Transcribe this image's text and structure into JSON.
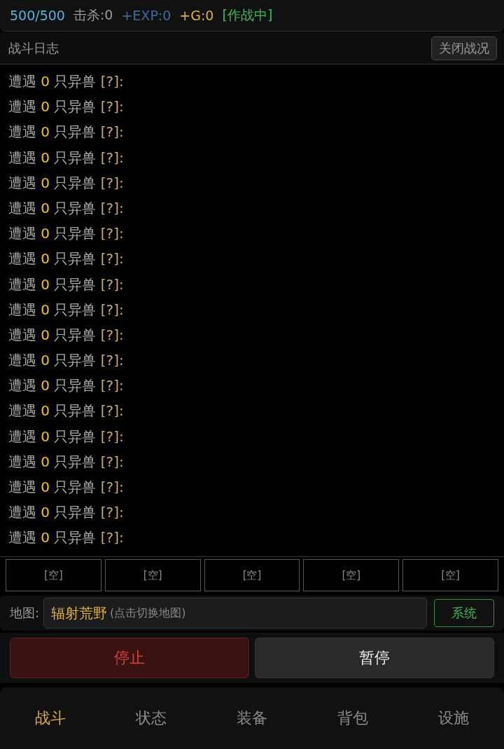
{
  "status_bar": {
    "hp": "500/500",
    "kills": "击杀:0",
    "exp": "+EXP:0",
    "gold": "+G:0",
    "state": "[作战中]"
  },
  "log_header": {
    "title": "战斗日志",
    "close_button": "关闭战况"
  },
  "log_entries": [
    {
      "verb": "遭遇",
      "count": "0",
      "noun": "只异兽",
      "tag": "[?]:"
    },
    {
      "verb": "遭遇",
      "count": "0",
      "noun": "只异兽",
      "tag": "[?]:"
    },
    {
      "verb": "遭遇",
      "count": "0",
      "noun": "只异兽",
      "tag": "[?]:"
    },
    {
      "verb": "遭遇",
      "count": "0",
      "noun": "只异兽",
      "tag": "[?]:"
    },
    {
      "verb": "遭遇",
      "count": "0",
      "noun": "只异兽",
      "tag": "[?]:"
    },
    {
      "verb": "遭遇",
      "count": "0",
      "noun": "只异兽",
      "tag": "[?]:"
    },
    {
      "verb": "遭遇",
      "count": "0",
      "noun": "只异兽",
      "tag": "[?]:"
    },
    {
      "verb": "遭遇",
      "count": "0",
      "noun": "只异兽",
      "tag": "[?]:"
    },
    {
      "verb": "遭遇",
      "count": "0",
      "noun": "只异兽",
      "tag": "[?]:"
    },
    {
      "verb": "遭遇",
      "count": "0",
      "noun": "只异兽",
      "tag": "[?]:"
    },
    {
      "verb": "遭遇",
      "count": "0",
      "noun": "只异兽",
      "tag": "[?]:"
    },
    {
      "verb": "遭遇",
      "count": "0",
      "noun": "只异兽",
      "tag": "[?]:"
    },
    {
      "verb": "遭遇",
      "count": "0",
      "noun": "只异兽",
      "tag": "[?]:"
    },
    {
      "verb": "遭遇",
      "count": "0",
      "noun": "只异兽",
      "tag": "[?]:"
    },
    {
      "verb": "遭遇",
      "count": "0",
      "noun": "只异兽",
      "tag": "[?]:"
    },
    {
      "verb": "遭遇",
      "count": "0",
      "noun": "只异兽",
      "tag": "[?]:"
    },
    {
      "verb": "遭遇",
      "count": "0",
      "noun": "只异兽",
      "tag": "[?]:"
    },
    {
      "verb": "遭遇",
      "count": "0",
      "noun": "只异兽",
      "tag": "[?]:"
    },
    {
      "verb": "遭遇",
      "count": "0",
      "noun": "只异兽",
      "tag": "[?]:"
    }
  ],
  "slots": [
    "[空]",
    "[空]",
    "[空]",
    "[空]",
    "[空]"
  ],
  "map": {
    "label": "地图:",
    "name": "辐射荒野",
    "hint": "(点击切换地图)",
    "system_button": "系统"
  },
  "actions": [
    {
      "label": "停止",
      "kind": "danger"
    },
    {
      "label": "暂停",
      "kind": "normal"
    }
  ],
  "nav": [
    {
      "label": "战斗",
      "selected": true
    },
    {
      "label": "状态",
      "selected": false
    },
    {
      "label": "装备",
      "selected": false
    },
    {
      "label": "背包",
      "selected": false
    },
    {
      "label": "设施",
      "selected": false
    }
  ]
}
